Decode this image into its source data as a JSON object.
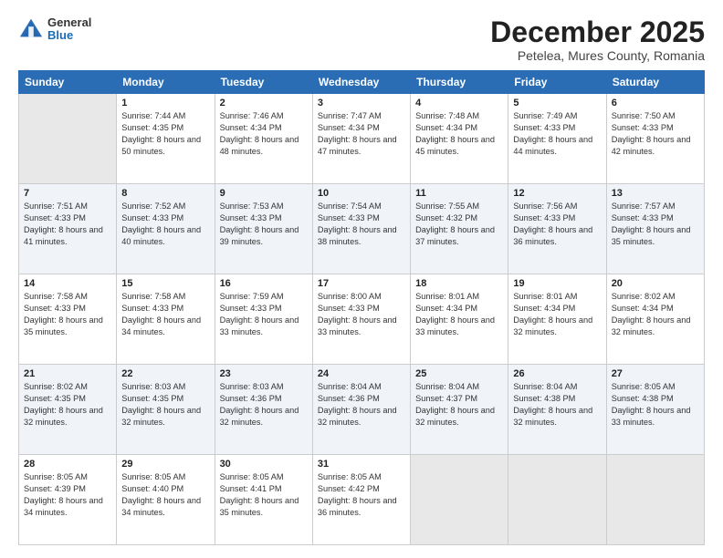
{
  "header": {
    "logo": {
      "general": "General",
      "blue": "Blue"
    },
    "title": "December 2025",
    "subtitle": "Petelea, Mures County, Romania"
  },
  "days": [
    "Sunday",
    "Monday",
    "Tuesday",
    "Wednesday",
    "Thursday",
    "Friday",
    "Saturday"
  ],
  "weeks": [
    [
      {
        "num": "",
        "sunrise": "",
        "sunset": "",
        "daylight": "",
        "empty": true
      },
      {
        "num": "1",
        "sunrise": "Sunrise: 7:44 AM",
        "sunset": "Sunset: 4:35 PM",
        "daylight": "Daylight: 8 hours and 50 minutes."
      },
      {
        "num": "2",
        "sunrise": "Sunrise: 7:46 AM",
        "sunset": "Sunset: 4:34 PM",
        "daylight": "Daylight: 8 hours and 48 minutes."
      },
      {
        "num": "3",
        "sunrise": "Sunrise: 7:47 AM",
        "sunset": "Sunset: 4:34 PM",
        "daylight": "Daylight: 8 hours and 47 minutes."
      },
      {
        "num": "4",
        "sunrise": "Sunrise: 7:48 AM",
        "sunset": "Sunset: 4:34 PM",
        "daylight": "Daylight: 8 hours and 45 minutes."
      },
      {
        "num": "5",
        "sunrise": "Sunrise: 7:49 AM",
        "sunset": "Sunset: 4:33 PM",
        "daylight": "Daylight: 8 hours and 44 minutes."
      },
      {
        "num": "6",
        "sunrise": "Sunrise: 7:50 AM",
        "sunset": "Sunset: 4:33 PM",
        "daylight": "Daylight: 8 hours and 42 minutes."
      }
    ],
    [
      {
        "num": "7",
        "sunrise": "Sunrise: 7:51 AM",
        "sunset": "Sunset: 4:33 PM",
        "daylight": "Daylight: 8 hours and 41 minutes."
      },
      {
        "num": "8",
        "sunrise": "Sunrise: 7:52 AM",
        "sunset": "Sunset: 4:33 PM",
        "daylight": "Daylight: 8 hours and 40 minutes."
      },
      {
        "num": "9",
        "sunrise": "Sunrise: 7:53 AM",
        "sunset": "Sunset: 4:33 PM",
        "daylight": "Daylight: 8 hours and 39 minutes."
      },
      {
        "num": "10",
        "sunrise": "Sunrise: 7:54 AM",
        "sunset": "Sunset: 4:33 PM",
        "daylight": "Daylight: 8 hours and 38 minutes."
      },
      {
        "num": "11",
        "sunrise": "Sunrise: 7:55 AM",
        "sunset": "Sunset: 4:32 PM",
        "daylight": "Daylight: 8 hours and 37 minutes."
      },
      {
        "num": "12",
        "sunrise": "Sunrise: 7:56 AM",
        "sunset": "Sunset: 4:33 PM",
        "daylight": "Daylight: 8 hours and 36 minutes."
      },
      {
        "num": "13",
        "sunrise": "Sunrise: 7:57 AM",
        "sunset": "Sunset: 4:33 PM",
        "daylight": "Daylight: 8 hours and 35 minutes."
      }
    ],
    [
      {
        "num": "14",
        "sunrise": "Sunrise: 7:58 AM",
        "sunset": "Sunset: 4:33 PM",
        "daylight": "Daylight: 8 hours and 35 minutes."
      },
      {
        "num": "15",
        "sunrise": "Sunrise: 7:58 AM",
        "sunset": "Sunset: 4:33 PM",
        "daylight": "Daylight: 8 hours and 34 minutes."
      },
      {
        "num": "16",
        "sunrise": "Sunrise: 7:59 AM",
        "sunset": "Sunset: 4:33 PM",
        "daylight": "Daylight: 8 hours and 33 minutes."
      },
      {
        "num": "17",
        "sunrise": "Sunrise: 8:00 AM",
        "sunset": "Sunset: 4:33 PM",
        "daylight": "Daylight: 8 hours and 33 minutes."
      },
      {
        "num": "18",
        "sunrise": "Sunrise: 8:01 AM",
        "sunset": "Sunset: 4:34 PM",
        "daylight": "Daylight: 8 hours and 33 minutes."
      },
      {
        "num": "19",
        "sunrise": "Sunrise: 8:01 AM",
        "sunset": "Sunset: 4:34 PM",
        "daylight": "Daylight: 8 hours and 32 minutes."
      },
      {
        "num": "20",
        "sunrise": "Sunrise: 8:02 AM",
        "sunset": "Sunset: 4:34 PM",
        "daylight": "Daylight: 8 hours and 32 minutes."
      }
    ],
    [
      {
        "num": "21",
        "sunrise": "Sunrise: 8:02 AM",
        "sunset": "Sunset: 4:35 PM",
        "daylight": "Daylight: 8 hours and 32 minutes."
      },
      {
        "num": "22",
        "sunrise": "Sunrise: 8:03 AM",
        "sunset": "Sunset: 4:35 PM",
        "daylight": "Daylight: 8 hours and 32 minutes."
      },
      {
        "num": "23",
        "sunrise": "Sunrise: 8:03 AM",
        "sunset": "Sunset: 4:36 PM",
        "daylight": "Daylight: 8 hours and 32 minutes."
      },
      {
        "num": "24",
        "sunrise": "Sunrise: 8:04 AM",
        "sunset": "Sunset: 4:36 PM",
        "daylight": "Daylight: 8 hours and 32 minutes."
      },
      {
        "num": "25",
        "sunrise": "Sunrise: 8:04 AM",
        "sunset": "Sunset: 4:37 PM",
        "daylight": "Daylight: 8 hours and 32 minutes."
      },
      {
        "num": "26",
        "sunrise": "Sunrise: 8:04 AM",
        "sunset": "Sunset: 4:38 PM",
        "daylight": "Daylight: 8 hours and 32 minutes."
      },
      {
        "num": "27",
        "sunrise": "Sunrise: 8:05 AM",
        "sunset": "Sunset: 4:38 PM",
        "daylight": "Daylight: 8 hours and 33 minutes."
      }
    ],
    [
      {
        "num": "28",
        "sunrise": "Sunrise: 8:05 AM",
        "sunset": "Sunset: 4:39 PM",
        "daylight": "Daylight: 8 hours and 34 minutes."
      },
      {
        "num": "29",
        "sunrise": "Sunrise: 8:05 AM",
        "sunset": "Sunset: 4:40 PM",
        "daylight": "Daylight: 8 hours and 34 minutes."
      },
      {
        "num": "30",
        "sunrise": "Sunrise: 8:05 AM",
        "sunset": "Sunset: 4:41 PM",
        "daylight": "Daylight: 8 hours and 35 minutes."
      },
      {
        "num": "31",
        "sunrise": "Sunrise: 8:05 AM",
        "sunset": "Sunset: 4:42 PM",
        "daylight": "Daylight: 8 hours and 36 minutes."
      },
      {
        "num": "",
        "sunrise": "",
        "sunset": "",
        "daylight": "",
        "empty": true
      },
      {
        "num": "",
        "sunrise": "",
        "sunset": "",
        "daylight": "",
        "empty": true
      },
      {
        "num": "",
        "sunrise": "",
        "sunset": "",
        "daylight": "",
        "empty": true
      }
    ]
  ]
}
